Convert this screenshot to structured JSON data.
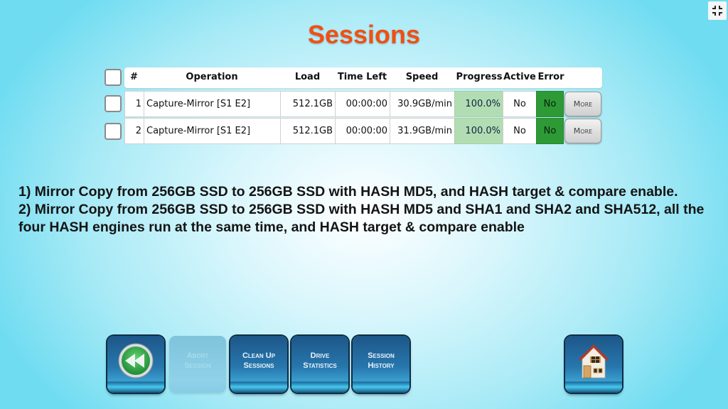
{
  "window": {
    "exit_fullscreen_icon": "exit-fullscreen-icon"
  },
  "header": {
    "title": "Sessions"
  },
  "table": {
    "columns": [
      "#",
      "Operation",
      "Load",
      "Time Left",
      "Speed",
      "Progress",
      "Active",
      "Error"
    ],
    "rows": [
      {
        "num": "1",
        "operation": "Capture-Mirror [S1 E2]",
        "load": "512.1GB",
        "time_left": "00:00:00",
        "speed": "30.9GB/min",
        "progress": "100.0%",
        "active": "No",
        "error": "No",
        "more_label": "More"
      },
      {
        "num": "2",
        "operation": "Capture-Mirror [S1 E2]",
        "load": "512.1GB",
        "time_left": "00:00:00",
        "speed": "31.9GB/min",
        "progress": "100.0%",
        "active": "No",
        "error": "No",
        "more_label": "More"
      }
    ],
    "colors": {
      "progress_fill": "#b2dcb2",
      "error_ok": "#2d9a36"
    }
  },
  "description": {
    "line1": "1) Mirror Copy from 256GB SSD to 256GB SSD with HASH MD5, and HASH target & compare enable.",
    "line2": "2) Mirror Copy from 256GB SSD to 256GB SSD with HASH MD5 and SHA1 and SHA2 and SHA512, all the four HASH engines run at the same time, and HASH target & compare enable"
  },
  "toolbar": {
    "back_icon": "rewind-icon",
    "abort_line1": "Abort",
    "abort_line2": "Session",
    "cleanup_line1": "Clean Up",
    "cleanup_line2": "Sessions",
    "drive_line1": "Drive",
    "drive_line2": "Statistics",
    "history_line1": "Session",
    "history_line2": "History",
    "home_icon": "home-icon"
  },
  "colors": {
    "title": "#f05014",
    "button_blue": "#2777ad"
  }
}
